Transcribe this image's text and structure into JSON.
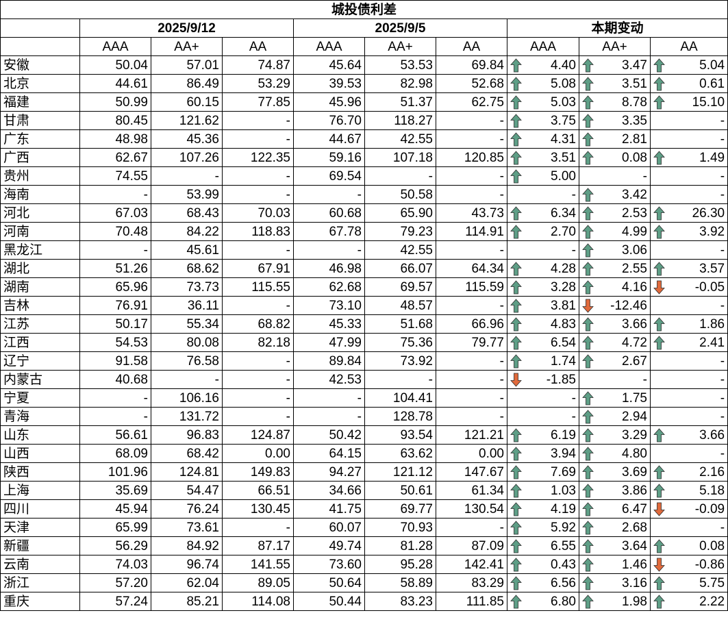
{
  "title": "城投债利差",
  "groups": [
    "2025/9/12",
    "2025/9/5",
    "本期变动"
  ],
  "ratings": [
    "AAA",
    "AA+",
    "AA"
  ],
  "colors": {
    "up": "#5e9e86",
    "down": "#e06a3c"
  },
  "rows": [
    {
      "region": "安徽",
      "cur": [
        "50.04",
        "57.01",
        "74.87"
      ],
      "prev": [
        "45.64",
        "53.53",
        "69.84"
      ],
      "chg": [
        {
          "v": "4.40",
          "dir": "up"
        },
        {
          "v": "3.47",
          "dir": "up"
        },
        {
          "v": "5.04",
          "dir": "up"
        }
      ]
    },
    {
      "region": "北京",
      "cur": [
        "44.61",
        "86.49",
        "53.29"
      ],
      "prev": [
        "39.53",
        "82.98",
        "52.68"
      ],
      "chg": [
        {
          "v": "5.08",
          "dir": "up"
        },
        {
          "v": "3.51",
          "dir": "up"
        },
        {
          "v": "0.61",
          "dir": "up"
        }
      ]
    },
    {
      "region": "福建",
      "cur": [
        "50.99",
        "60.15",
        "77.85"
      ],
      "prev": [
        "45.96",
        "51.37",
        "62.75"
      ],
      "chg": [
        {
          "v": "5.03",
          "dir": "up"
        },
        {
          "v": "8.78",
          "dir": "up"
        },
        {
          "v": "15.10",
          "dir": "up"
        }
      ]
    },
    {
      "region": "甘肃",
      "cur": [
        "80.45",
        "121.62",
        "-"
      ],
      "prev": [
        "76.70",
        "118.27",
        "-"
      ],
      "chg": [
        {
          "v": "3.75",
          "dir": "up"
        },
        {
          "v": "3.35",
          "dir": "up"
        },
        {
          "v": "-",
          "dir": ""
        }
      ]
    },
    {
      "region": "广东",
      "cur": [
        "48.98",
        "45.36",
        "-"
      ],
      "prev": [
        "44.67",
        "42.55",
        "-"
      ],
      "chg": [
        {
          "v": "4.31",
          "dir": "up"
        },
        {
          "v": "2.81",
          "dir": "up"
        },
        {
          "v": "-",
          "dir": ""
        }
      ]
    },
    {
      "region": "广西",
      "cur": [
        "62.67",
        "107.26",
        "122.35"
      ],
      "prev": [
        "59.16",
        "107.18",
        "120.85"
      ],
      "chg": [
        {
          "v": "3.51",
          "dir": "up"
        },
        {
          "v": "0.08",
          "dir": "up"
        },
        {
          "v": "1.49",
          "dir": "up"
        }
      ]
    },
    {
      "region": "贵州",
      "cur": [
        "74.55",
        "-",
        "-"
      ],
      "prev": [
        "69.54",
        "-",
        "-"
      ],
      "chg": [
        {
          "v": "5.00",
          "dir": "up"
        },
        {
          "v": "-",
          "dir": ""
        },
        {
          "v": "-",
          "dir": ""
        }
      ]
    },
    {
      "region": "海南",
      "cur": [
        "-",
        "53.99",
        "-"
      ],
      "prev": [
        "-",
        "50.58",
        "-"
      ],
      "chg": [
        {
          "v": "-",
          "dir": ""
        },
        {
          "v": "3.42",
          "dir": "up"
        },
        {
          "v": "-",
          "dir": ""
        }
      ]
    },
    {
      "region": "河北",
      "cur": [
        "67.03",
        "68.43",
        "70.03"
      ],
      "prev": [
        "60.68",
        "65.90",
        "43.73"
      ],
      "chg": [
        {
          "v": "6.34",
          "dir": "up"
        },
        {
          "v": "2.53",
          "dir": "up"
        },
        {
          "v": "26.30",
          "dir": "up"
        }
      ]
    },
    {
      "region": "河南",
      "cur": [
        "70.48",
        "84.22",
        "118.83"
      ],
      "prev": [
        "67.78",
        "79.23",
        "114.91"
      ],
      "chg": [
        {
          "v": "2.70",
          "dir": "up"
        },
        {
          "v": "4.99",
          "dir": "up"
        },
        {
          "v": "3.92",
          "dir": "up"
        }
      ]
    },
    {
      "region": "黑龙江",
      "cur": [
        "-",
        "45.61",
        "-"
      ],
      "prev": [
        "-",
        "42.55",
        "-"
      ],
      "chg": [
        {
          "v": "-",
          "dir": ""
        },
        {
          "v": "3.06",
          "dir": "up"
        },
        {
          "v": "-",
          "dir": ""
        }
      ]
    },
    {
      "region": "湖北",
      "cur": [
        "51.26",
        "68.62",
        "67.91"
      ],
      "prev": [
        "46.98",
        "66.07",
        "64.34"
      ],
      "chg": [
        {
          "v": "4.28",
          "dir": "up"
        },
        {
          "v": "2.55",
          "dir": "up"
        },
        {
          "v": "3.57",
          "dir": "up"
        }
      ]
    },
    {
      "region": "湖南",
      "cur": [
        "65.96",
        "73.73",
        "115.55"
      ],
      "prev": [
        "62.68",
        "69.57",
        "115.59"
      ],
      "chg": [
        {
          "v": "3.28",
          "dir": "up"
        },
        {
          "v": "4.16",
          "dir": "up"
        },
        {
          "v": "-0.05",
          "dir": "down"
        }
      ]
    },
    {
      "region": "吉林",
      "cur": [
        "76.91",
        "36.11",
        "-"
      ],
      "prev": [
        "73.10",
        "48.57",
        "-"
      ],
      "chg": [
        {
          "v": "3.81",
          "dir": "up"
        },
        {
          "v": "-12.46",
          "dir": "down"
        },
        {
          "v": "-",
          "dir": ""
        }
      ]
    },
    {
      "region": "江苏",
      "cur": [
        "50.17",
        "55.34",
        "68.82"
      ],
      "prev": [
        "45.33",
        "51.68",
        "66.96"
      ],
      "chg": [
        {
          "v": "4.83",
          "dir": "up"
        },
        {
          "v": "3.66",
          "dir": "up"
        },
        {
          "v": "1.86",
          "dir": "up"
        }
      ]
    },
    {
      "region": "江西",
      "cur": [
        "54.53",
        "80.08",
        "82.18"
      ],
      "prev": [
        "47.99",
        "75.36",
        "79.77"
      ],
      "chg": [
        {
          "v": "6.54",
          "dir": "up"
        },
        {
          "v": "4.72",
          "dir": "up"
        },
        {
          "v": "2.41",
          "dir": "up"
        }
      ]
    },
    {
      "region": "辽宁",
      "cur": [
        "91.58",
        "76.58",
        "-"
      ],
      "prev": [
        "89.84",
        "73.92",
        "-"
      ],
      "chg": [
        {
          "v": "1.74",
          "dir": "up"
        },
        {
          "v": "2.67",
          "dir": "up"
        },
        {
          "v": "-",
          "dir": ""
        }
      ]
    },
    {
      "region": "内蒙古",
      "cur": [
        "40.68",
        "-",
        "-"
      ],
      "prev": [
        "42.53",
        "-",
        "-"
      ],
      "chg": [
        {
          "v": "-1.85",
          "dir": "down"
        },
        {
          "v": "-",
          "dir": ""
        },
        {
          "v": "-",
          "dir": ""
        }
      ]
    },
    {
      "region": "宁夏",
      "cur": [
        "-",
        "106.16",
        "-"
      ],
      "prev": [
        "-",
        "104.41",
        "-"
      ],
      "chg": [
        {
          "v": "-",
          "dir": ""
        },
        {
          "v": "1.75",
          "dir": "up"
        },
        {
          "v": "-",
          "dir": ""
        }
      ]
    },
    {
      "region": "青海",
      "cur": [
        "-",
        "131.72",
        "-"
      ],
      "prev": [
        "-",
        "128.78",
        "-"
      ],
      "chg": [
        {
          "v": "-",
          "dir": ""
        },
        {
          "v": "2.94",
          "dir": "up"
        },
        {
          "v": "-",
          "dir": ""
        }
      ]
    },
    {
      "region": "山东",
      "cur": [
        "56.61",
        "96.83",
        "124.87"
      ],
      "prev": [
        "50.42",
        "93.54",
        "121.21"
      ],
      "chg": [
        {
          "v": "6.19",
          "dir": "up"
        },
        {
          "v": "3.29",
          "dir": "up"
        },
        {
          "v": "3.66",
          "dir": "up"
        }
      ]
    },
    {
      "region": "山西",
      "cur": [
        "68.09",
        "68.42",
        "0.00"
      ],
      "prev": [
        "64.15",
        "63.62",
        "0.00"
      ],
      "chg": [
        {
          "v": "3.94",
          "dir": "up"
        },
        {
          "v": "4.80",
          "dir": "up"
        },
        {
          "v": "-",
          "dir": ""
        }
      ]
    },
    {
      "region": "陕西",
      "cur": [
        "101.96",
        "124.81",
        "149.83"
      ],
      "prev": [
        "94.27",
        "121.12",
        "147.67"
      ],
      "chg": [
        {
          "v": "7.69",
          "dir": "up"
        },
        {
          "v": "3.69",
          "dir": "up"
        },
        {
          "v": "2.16",
          "dir": "up"
        }
      ]
    },
    {
      "region": "上海",
      "cur": [
        "35.69",
        "54.47",
        "66.51"
      ],
      "prev": [
        "34.66",
        "50.61",
        "61.34"
      ],
      "chg": [
        {
          "v": "1.03",
          "dir": "up"
        },
        {
          "v": "3.86",
          "dir": "up"
        },
        {
          "v": "5.18",
          "dir": "up"
        }
      ]
    },
    {
      "region": "四川",
      "cur": [
        "45.94",
        "76.24",
        "130.45"
      ],
      "prev": [
        "41.75",
        "69.77",
        "130.54"
      ],
      "chg": [
        {
          "v": "4.19",
          "dir": "up"
        },
        {
          "v": "6.47",
          "dir": "up"
        },
        {
          "v": "-0.09",
          "dir": "down"
        }
      ]
    },
    {
      "region": "天津",
      "cur": [
        "65.99",
        "73.61",
        "-"
      ],
      "prev": [
        "60.07",
        "70.93",
        "-"
      ],
      "chg": [
        {
          "v": "5.92",
          "dir": "up"
        },
        {
          "v": "2.68",
          "dir": "up"
        },
        {
          "v": "-",
          "dir": ""
        }
      ]
    },
    {
      "region": "新疆",
      "cur": [
        "56.29",
        "84.92",
        "87.17"
      ],
      "prev": [
        "49.74",
        "81.28",
        "87.09"
      ],
      "chg": [
        {
          "v": "6.55",
          "dir": "up"
        },
        {
          "v": "3.64",
          "dir": "up"
        },
        {
          "v": "0.08",
          "dir": "up"
        }
      ]
    },
    {
      "region": "云南",
      "cur": [
        "74.03",
        "96.74",
        "141.55"
      ],
      "prev": [
        "73.60",
        "95.28",
        "142.41"
      ],
      "chg": [
        {
          "v": "0.43",
          "dir": "up"
        },
        {
          "v": "1.46",
          "dir": "up"
        },
        {
          "v": "-0.86",
          "dir": "down"
        }
      ]
    },
    {
      "region": "浙江",
      "cur": [
        "57.20",
        "62.04",
        "89.05"
      ],
      "prev": [
        "50.64",
        "58.89",
        "83.29"
      ],
      "chg": [
        {
          "v": "6.56",
          "dir": "up"
        },
        {
          "v": "3.16",
          "dir": "up"
        },
        {
          "v": "5.75",
          "dir": "up"
        }
      ]
    },
    {
      "region": "重庆",
      "cur": [
        "57.24",
        "85.21",
        "114.08"
      ],
      "prev": [
        "50.44",
        "83.23",
        "111.85"
      ],
      "chg": [
        {
          "v": "6.80",
          "dir": "up"
        },
        {
          "v": "1.98",
          "dir": "up"
        },
        {
          "v": "2.22",
          "dir": "up"
        }
      ]
    }
  ]
}
